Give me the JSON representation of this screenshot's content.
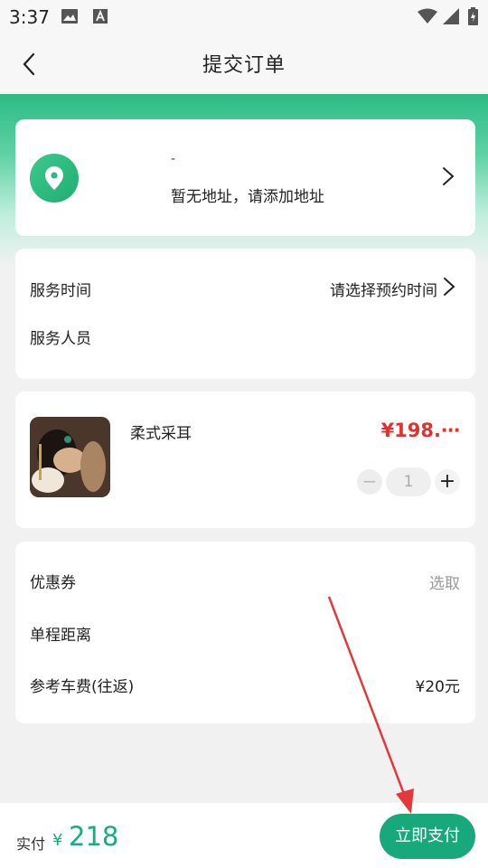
{
  "status_bar": {
    "time": "3:37",
    "icons": [
      "image-icon",
      "a-icon",
      "wifi-icon",
      "signal-icon",
      "battery-icon"
    ]
  },
  "nav": {
    "title": "提交订单",
    "back_icon": "chevron-left-icon"
  },
  "colors": {
    "accent": "#17a97a",
    "price": "#e2312e",
    "arrow": "#e23a3a"
  },
  "address": {
    "dash": "-",
    "text": "暂无地址，请添加地址",
    "icon": "location-pin-icon"
  },
  "service": {
    "time_label": "服务时间",
    "time_value": "请选择预约时间",
    "staff_label": "服务人员"
  },
  "product": {
    "name": "柔式采耳",
    "price": "¥198.⋯",
    "quantity": "1",
    "minus": "−",
    "plus": "+"
  },
  "fees": {
    "coupon_label": "优惠券",
    "coupon_value": "选取",
    "distance_label": "单程距离",
    "fare_label": "参考车费(往返)",
    "fare_value": "¥20元"
  },
  "bottom": {
    "pay_label": "实付",
    "currency": "¥",
    "amount": "218",
    "pay_button": "立即支付"
  }
}
